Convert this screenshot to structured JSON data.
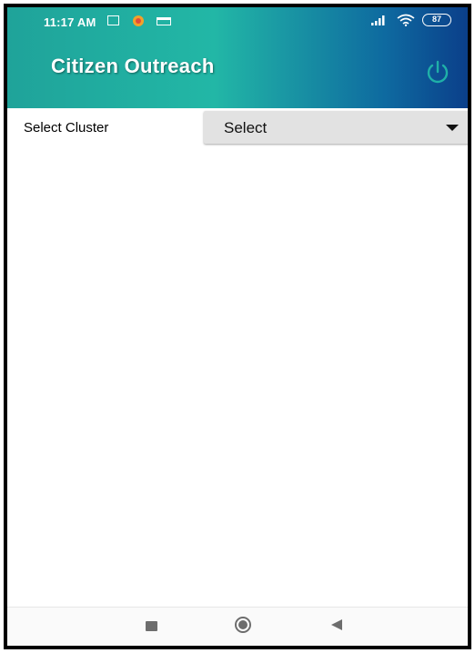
{
  "status_bar": {
    "time": "11:17 AM",
    "battery": "87",
    "icons": [
      "sim-icon",
      "notification-icon",
      "message-icon",
      "signal-icon",
      "wifi-icon",
      "battery-icon"
    ]
  },
  "app_bar": {
    "title": "Citizen Outreach",
    "power_icon": "power-icon",
    "colors": {
      "start": "#1fa39a",
      "mid": "#22b7a6",
      "end": "#0b3f8a"
    }
  },
  "filter": {
    "label": "Select Cluster",
    "select_value": "Select"
  },
  "nav_bar": {
    "icons": [
      "recents-icon",
      "home-icon",
      "back-icon"
    ]
  }
}
